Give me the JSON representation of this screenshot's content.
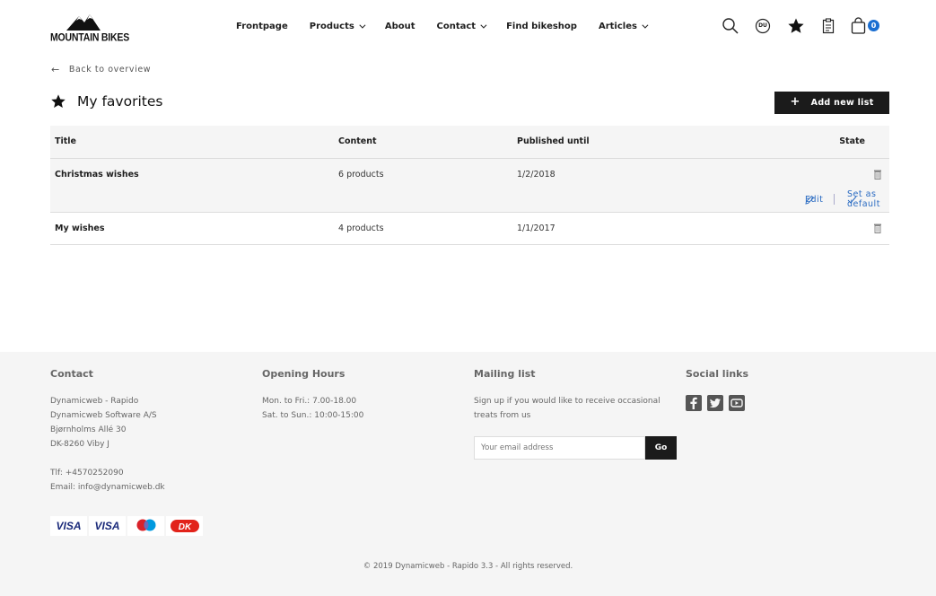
{
  "brand": {
    "logo_text": "MOUNTAIN BIKES"
  },
  "nav": [
    {
      "label": "Frontpage",
      "dropdown": false
    },
    {
      "label": "Products",
      "dropdown": true
    },
    {
      "label": "About",
      "dropdown": false
    },
    {
      "label": "Contact",
      "dropdown": true
    },
    {
      "label": "Find bikeshop",
      "dropdown": false
    },
    {
      "label": "Articles",
      "dropdown": true
    }
  ],
  "tools": {
    "user_initials": "DU",
    "cart_count": "0"
  },
  "back_link": "Back to overview",
  "page": {
    "title": "My favorites",
    "add_button": "Add new list"
  },
  "table": {
    "headers": {
      "title": "Title",
      "content": "Content",
      "published": "Published until",
      "state": "State"
    },
    "rows": [
      {
        "title": "Christmas wishes",
        "content": "6 products",
        "published": "1/2/2018",
        "edit": "Edit",
        "set_default": "Set as default"
      },
      {
        "title": "My wishes",
        "content": "4 products",
        "published": "1/1/2017"
      }
    ]
  },
  "footer": {
    "contact": {
      "heading": "Contact",
      "lines": [
        "Dynamicweb - Rapido",
        "Dynamicweb Software A/S",
        "Bjørnholms Allé 30",
        "DK-8260 Viby J"
      ],
      "phone": "Tlf: +4570252090",
      "email": "Email: info@dynamicweb.dk"
    },
    "hours": {
      "heading": "Opening Hours",
      "lines": [
        "Mon. to Fri.: 7.00-18.00",
        "Sat. to Sun.: 10:00-15:00"
      ]
    },
    "mailing": {
      "heading": "Mailing list",
      "lines": [
        "Sign up if you would like to receive occasional",
        "treats from us"
      ],
      "placeholder": "Your email address",
      "button": "Go"
    },
    "social": {
      "heading": "Social links",
      "icons": [
        "facebook-icon",
        "twitter-icon",
        "youtube-icon"
      ]
    },
    "payments": [
      "VISA",
      "VISA",
      "maestro",
      "DK"
    ],
    "copyright": "© 2019 Dynamicweb - Rapido 3.3 - All rights reserved."
  },
  "colors": {
    "accent": "#1a6ed1",
    "link": "#2a6bc2",
    "dark": "#1b1b1b",
    "footer_bg": "#f5f5f5"
  }
}
